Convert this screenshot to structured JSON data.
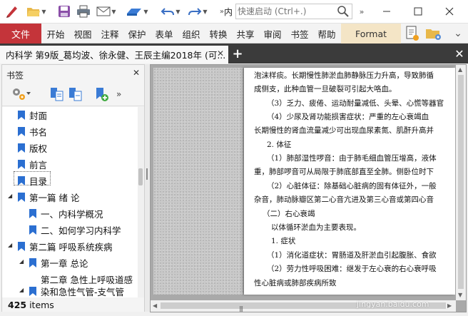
{
  "quick_access": {
    "search_placeholder": "快速启动 (Ctrl+.)",
    "search_prefix": "内",
    "accent_color": "#c4343a"
  },
  "ribbon": {
    "file_tab": "文件",
    "tabs": [
      "开始",
      "视图",
      "注释",
      "保护",
      "表单",
      "组织",
      "转换",
      "共享",
      "审阅",
      "书签",
      "帮助"
    ],
    "context_tab": "Format"
  },
  "document_tab": {
    "title": "内科学 第9版_葛均波、徐永健、王辰主编2018年 (可..."
  },
  "bookmarks_panel": {
    "title": "书签",
    "items": [
      {
        "label": "封面"
      },
      {
        "label": "书名"
      },
      {
        "label": "版权"
      },
      {
        "label": "前言"
      },
      {
        "label": "目录"
      },
      {
        "label": "第一篇 绪 论"
      },
      {
        "label": "一、内科学概况"
      },
      {
        "label": "二、如何学习内科学"
      },
      {
        "label": "第二篇 呼吸系统疾病"
      },
      {
        "label": "第一章 总论"
      },
      {
        "label": "第二章 急性上呼吸道感"
      },
      {
        "label": "染和急性气管-支气管"
      }
    ],
    "status_count": "425",
    "status_suffix": " items"
  },
  "page_text": {
    "lines": [
      "泡沫样痰。长期慢性肺淤血肺静脉压力升高，导致肺循",
      "成侧支，此种血管一旦破裂可引起大咯血。",
      "（3）乏力、疲倦、运动耐量减低、头晕、心慌等器官",
      "（4）少尿及肾功能损害症状：严重的左心衰竭血",
      "长期慢性的肾血流量减少可出现血尿素氮、肌酐升高并",
      "2. 体征",
      "（1）肺部湿性啰音：由于肺毛细血管压增高，液体",
      "重，肺部啰音可从局限于肺底部直至全肺。侧卧位时下",
      "（2）心脏体征：除基础心脏病的固有体征外，一般",
      "杂音，肺动脉瓣区第二心音亢进及第三心音或第四心音",
      "（二）右心衰竭",
      "以体循环淤血为主要表现。",
      "1. 症状",
      "（1）消化道症状：胃肠道及肝淤血引起腹胀、食欲",
      "（2）劳力性呼吸困难：继发于左心衰的右心衰呼吸",
      "性心脏病或肺部疾病所致"
    ]
  },
  "watermark": "jingyan.baidu.com"
}
